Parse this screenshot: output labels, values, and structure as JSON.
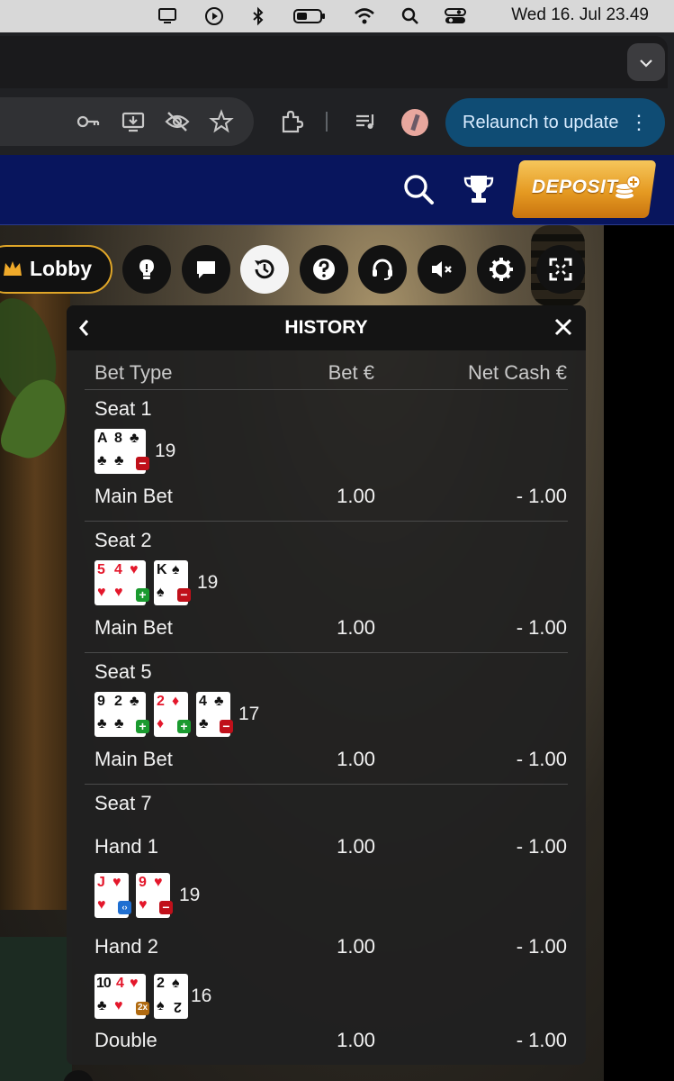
{
  "menubar": {
    "clock": "Wed 16. Jul  23.49",
    "icons": [
      "display-icon",
      "play-circle-icon",
      "bluetooth-icon",
      "battery-icon",
      "wifi-icon",
      "search-icon",
      "control-center-icon"
    ]
  },
  "browser": {
    "relaunch_label": "Relaunch to update",
    "toolbar_icons": [
      "key-icon",
      "install-app-icon",
      "eye-off-icon",
      "star-icon",
      "extensions-icon",
      "media-control-icon"
    ]
  },
  "casino": {
    "deposit_label": "DEPOSIT",
    "lobby_label": "Lobby",
    "controls": [
      "lightbulb-icon",
      "chat-icon",
      "history-icon",
      "help-icon",
      "support-headset-icon",
      "mute-icon",
      "settings-icon",
      "fullscreen-icon"
    ],
    "active_control": "history-icon"
  },
  "history": {
    "title": "HISTORY",
    "columns": {
      "bet_type": "Bet Type",
      "bet": "Bet €",
      "net": "Net Cash €"
    },
    "seats": [
      {
        "label": "Seat 1",
        "cards": [
          {
            "ranks": [
              "A",
              "8"
            ],
            "suit": "♣",
            "color": "#111111",
            "badge": "−"
          }
        ],
        "total": "19",
        "rows": [
          {
            "type": "Main Bet",
            "bet": "1.00",
            "net": "- 1.00"
          }
        ]
      },
      {
        "label": "Seat 2",
        "cards": [
          {
            "ranks": [
              "5",
              "4"
            ],
            "suit": "♥",
            "color": "#e4172b",
            "badge": "+"
          },
          {
            "ranks": [
              "K"
            ],
            "suit": "♠",
            "color": "#111111",
            "badge": "−"
          }
        ],
        "total": "19",
        "rows": [
          {
            "type": "Main Bet",
            "bet": "1.00",
            "net": "- 1.00"
          }
        ]
      },
      {
        "label": "Seat 5",
        "cards": [
          {
            "ranks": [
              "9",
              "2"
            ],
            "suit": "♣",
            "color": "#111111",
            "badge": "+"
          },
          {
            "ranks": [
              "2"
            ],
            "suit": "♦",
            "color": "#e4172b",
            "badge": "+"
          },
          {
            "ranks": [
              "4"
            ],
            "suit": "♣",
            "color": "#111111",
            "badge": "−"
          }
        ],
        "total": "17",
        "rows": [
          {
            "type": "Main Bet",
            "bet": "1.00",
            "net": "- 1.00"
          }
        ]
      },
      {
        "label": "Seat 7",
        "hands": [
          {
            "type": "Hand 1",
            "bet": "1.00",
            "net": "- 1.00",
            "cards": [
              {
                "ranks": [
                  "J"
                ],
                "suit": "♥",
                "color": "#e4172b",
                "badge": "‹›"
              },
              {
                "ranks": [
                  "9"
                ],
                "suit": "♥",
                "color": "#e4172b",
                "badge": "−"
              }
            ],
            "total": "19"
          },
          {
            "type": "Hand 2",
            "bet": "1.00",
            "net": "- 1.00",
            "cards": [
              {
                "ranks": [
                  "10",
                  "4"
                ],
                "suit": "♥",
                "color": "#111111",
                "badge": "2x"
              },
              {
                "ranks": [
                  "2"
                ],
                "suit": "♠",
                "color": "#111111",
                "badge": ""
              }
            ],
            "total": "16"
          }
        ],
        "rows": [
          {
            "type": "Double",
            "bet": "1.00",
            "net": "- 1.00"
          }
        ]
      }
    ]
  }
}
